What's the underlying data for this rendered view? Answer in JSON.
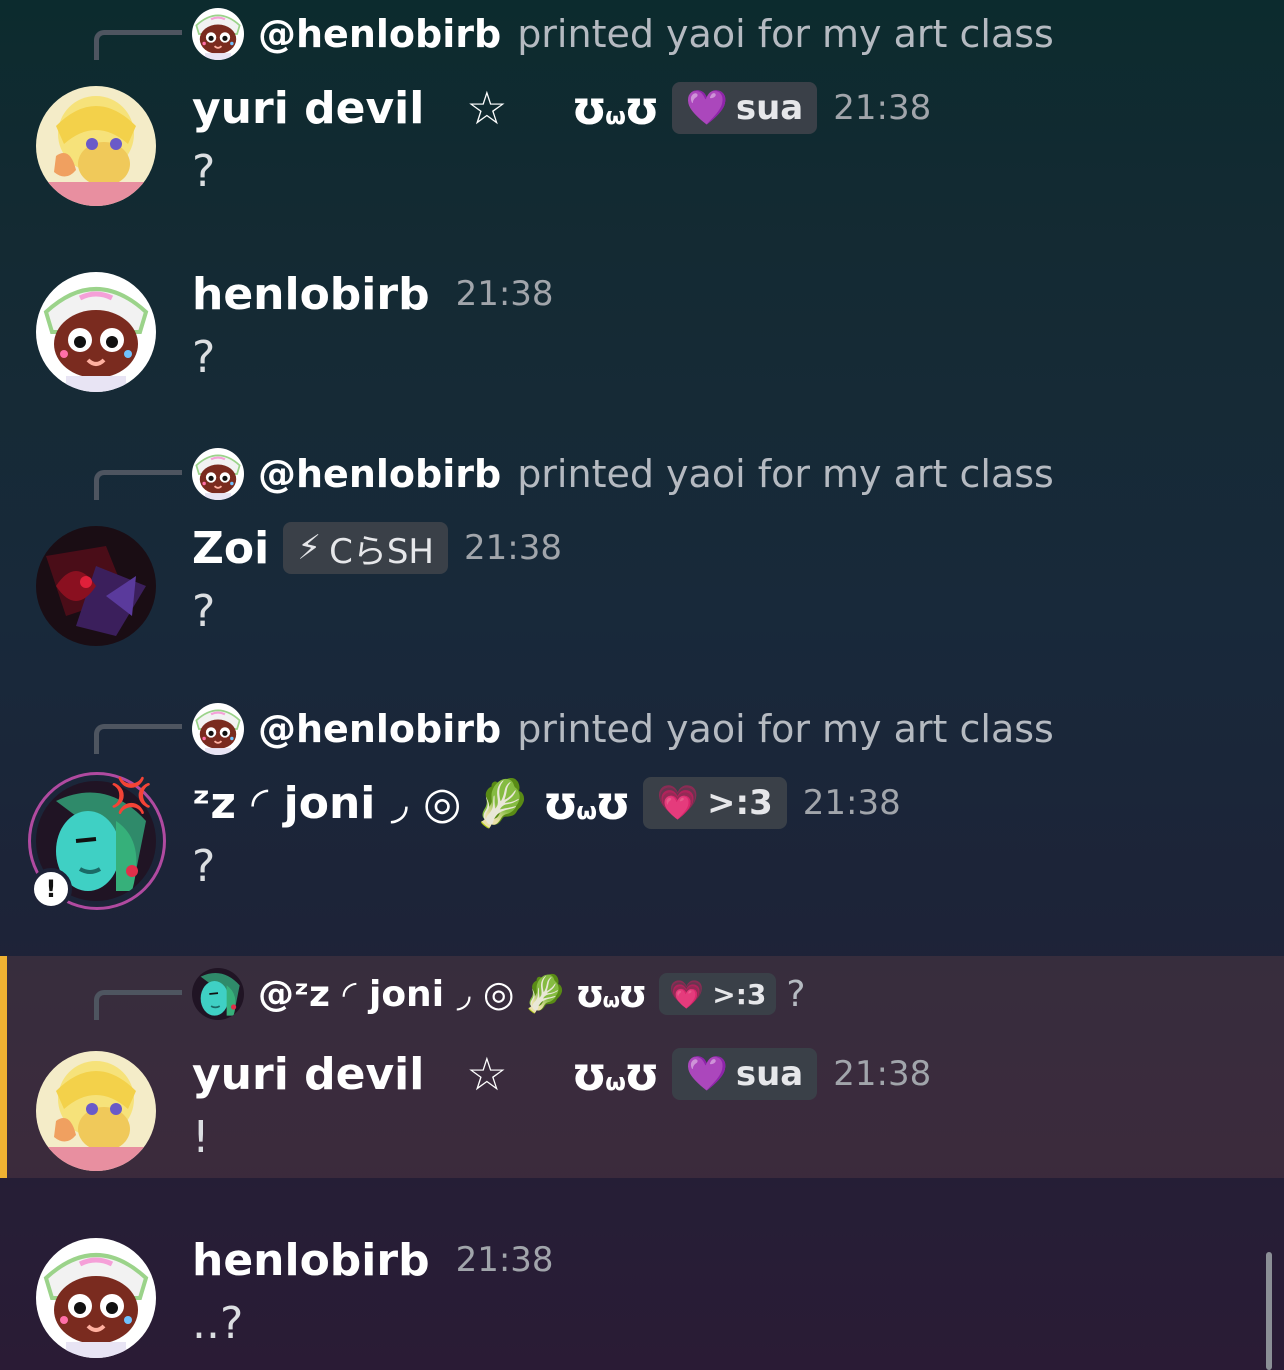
{
  "messages": [
    {
      "reply": {
        "author": "@henlobirb",
        "text": "printed yaoi for my art class"
      },
      "author": "yuri devil",
      "star": "☆",
      "owo": "ʊ",
      "owo_mouth": "ω",
      "tag": {
        "emoji": "💜",
        "label": "sua"
      },
      "time": "21:38",
      "content": "?"
    },
    {
      "author": "henlobirb",
      "time": "21:38",
      "content": "?"
    },
    {
      "reply": {
        "author": "@henlobirb",
        "text": "printed yaoi for my art class"
      },
      "author": "Zoi",
      "tag": {
        "emoji": "⚡",
        "label": "CらSH"
      },
      "time": "21:38",
      "content": "?"
    },
    {
      "reply": {
        "author": "@henlobirb",
        "text": "printed yaoi for my art class"
      },
      "author": "ᶻz ◜ joni ◞ ◎",
      "leaf": "🥬",
      "owo": "ʊ",
      "owo_mouth": "ω",
      "tag": {
        "emoji": "💗",
        "label": ">:3"
      },
      "time": "21:38",
      "content": "?"
    },
    {
      "reply": {
        "author": "@ᶻz ◜ joni ◞ ◎",
        "leaf": "🥬",
        "owo": "ʊ",
        "owo_mouth": "ω",
        "tag": {
          "emoji": "💗",
          "label": ">:3"
        },
        "text": "?"
      },
      "author": "yuri devil",
      "star": "☆",
      "owo": "ʊ",
      "owo_mouth": "ω",
      "tag": {
        "emoji": "💜",
        "label": "sua"
      },
      "time": "21:38",
      "content": "!"
    },
    {
      "author": "henlobirb",
      "time": "21:38",
      "content": "..?"
    }
  ],
  "badge": "!",
  "anger_mark": "💢",
  "colors": {
    "highlight_bar": "#f0b232",
    "tag_bg": "#3a4048",
    "timestamp": "#a1a5ab"
  }
}
